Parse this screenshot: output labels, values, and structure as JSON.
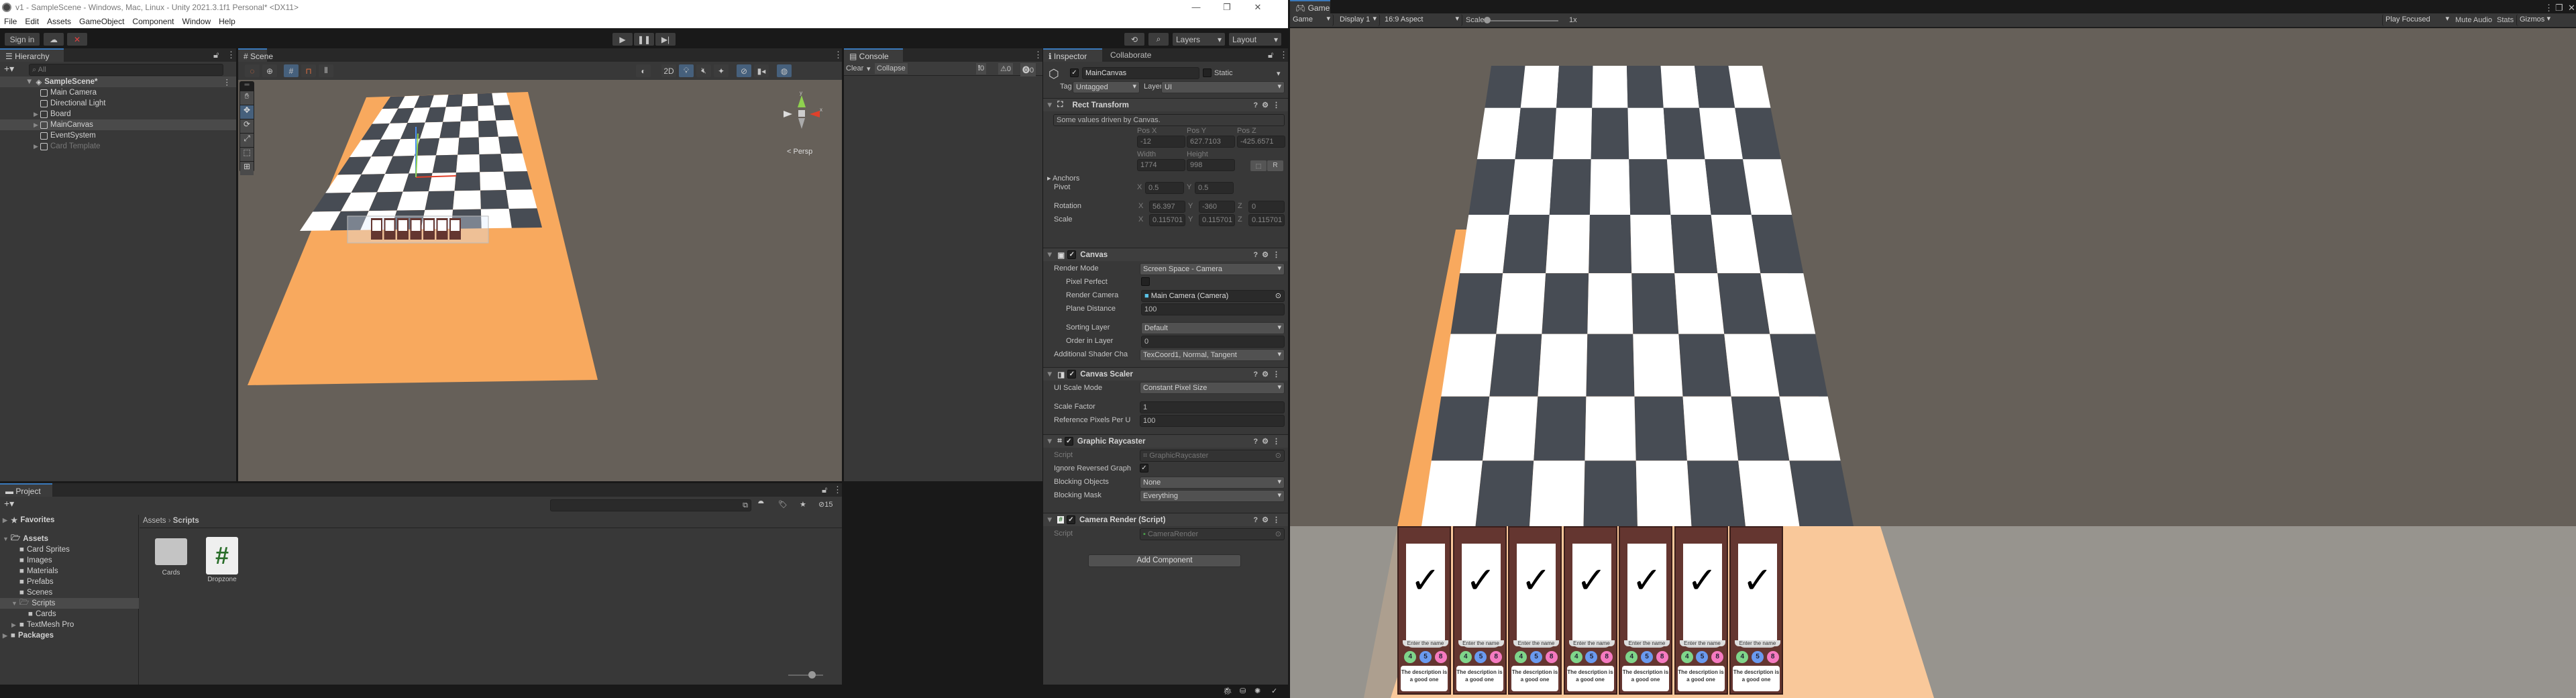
{
  "window": {
    "title": "v1 - SampleScene - Windows, Mac, Linux - Unity 2021.3.1f1 Personal* <DX11>",
    "menu": [
      "File",
      "Edit",
      "Assets",
      "GameObject",
      "Component",
      "Window",
      "Help"
    ]
  },
  "toolbar": {
    "sign_in": "Sign in",
    "play_controls": [
      "play",
      "pause",
      "step"
    ],
    "layers": "Layers",
    "layout": "Layout"
  },
  "hierarchy": {
    "tab": "Hierarchy",
    "search_placeholder": "All",
    "scene": "SampleScene*",
    "items": [
      {
        "label": "Main Camera",
        "expandable": false,
        "disabled": false,
        "selected": false
      },
      {
        "label": "Directional Light",
        "expandable": false,
        "disabled": false,
        "selected": false
      },
      {
        "label": "Board",
        "expandable": true,
        "disabled": false,
        "selected": false
      },
      {
        "label": "MainCanvas",
        "expandable": true,
        "disabled": false,
        "selected": true
      },
      {
        "label": "EventSystem",
        "expandable": false,
        "disabled": false,
        "selected": false
      },
      {
        "label": "Card Template",
        "expandable": true,
        "disabled": true,
        "selected": false
      }
    ]
  },
  "scene": {
    "tab": "Scene",
    "toolbar_2d": "2D",
    "persp_label": "< Persp",
    "gizmo_axes": {
      "y": "y",
      "x": "x"
    },
    "board": {
      "rows": 8,
      "cols": 8,
      "light": "#ffffff",
      "dark": "#474c54",
      "border": "#f8a95e"
    },
    "card_count": 7
  },
  "console": {
    "tab": "Console",
    "clear": "Clear",
    "collapse": "Collapse",
    "counts": {
      "log": "0",
      "warning": "0",
      "error": "0"
    }
  },
  "inspector": {
    "tab": "Inspector",
    "tab2": "Collaborate",
    "object_name": "MainCanvas",
    "active": true,
    "static_label": "Static",
    "tag_label": "Tag",
    "tag": "Untagged",
    "layer_label": "Layer",
    "layer": "UI",
    "rect_transform": {
      "title": "Rect Transform",
      "note": "Some values driven by Canvas.",
      "pos_x_label": "Pos X",
      "pos_y_label": "Pos Y",
      "pos_z_label": "Pos Z",
      "pos_x": "-12",
      "pos_y": "627.7103",
      "pos_z": "-425.6571",
      "width_label": "Width",
      "height_label": "Height",
      "width": "1774",
      "height": "998",
      "r_button": "R",
      "anchors": "Anchors",
      "pivot_label": "Pivot",
      "pivot_x": "0.5",
      "pivot_y": "0.5",
      "rotation_label": "Rotation",
      "rot_x": "56.397",
      "rot_y": "-360",
      "rot_z": "0",
      "scale_label": "Scale",
      "scale_x": "0.115701",
      "scale_y": "0.115701",
      "scale_z": "0.115701"
    },
    "canvas": {
      "title": "Canvas",
      "render_mode_label": "Render Mode",
      "render_mode": "Screen Space - Camera",
      "pixel_perfect_label": "Pixel Perfect",
      "pixel_perfect": false,
      "render_camera_label": "Render Camera",
      "render_camera": "Main Camera (Camera)",
      "plane_distance_label": "Plane Distance",
      "plane_distance": "100",
      "sorting_layer_label": "Sorting Layer",
      "sorting_layer": "Default",
      "order_label": "Order in Layer",
      "order": "0",
      "shader_label": "Additional Shader Cha",
      "shader": "TexCoord1, Normal, Tangent"
    },
    "canvas_scaler": {
      "title": "Canvas Scaler",
      "mode_label": "UI Scale Mode",
      "mode": "Constant Pixel Size",
      "scale_factor_label": "Scale Factor",
      "scale_factor": "1",
      "ref_ppu_label": "Reference Pixels Per U",
      "ref_ppu": "100"
    },
    "graphic_raycaster": {
      "title": "Graphic Raycaster",
      "script_label": "Script",
      "script": "GraphicRaycaster",
      "ignore_label": "Ignore Reversed Graph",
      "ignore": true,
      "blocking_objects_label": "Blocking Objects",
      "blocking_objects": "None",
      "blocking_mask_label": "Blocking Mask",
      "blocking_mask": "Everything"
    },
    "camera_render": {
      "title": "Camera Render (Script)",
      "script_label": "Script",
      "script": "CameraRender"
    },
    "add_component": "Add Component"
  },
  "project": {
    "tab": "Project",
    "hidden_count": "15",
    "tree": [
      {
        "label": "Favorites",
        "level": 0,
        "bold": true,
        "icon": "star",
        "arrow": "right"
      },
      {
        "label": "Assets",
        "level": 0,
        "bold": true,
        "icon": "folder-open",
        "arrow": "down"
      },
      {
        "label": "Card Sprites",
        "level": 1,
        "icon": "folder"
      },
      {
        "label": "Images",
        "level": 1,
        "icon": "folder"
      },
      {
        "label": "Materials",
        "level": 1,
        "icon": "folder"
      },
      {
        "label": "Prefabs",
        "level": 1,
        "icon": "folder"
      },
      {
        "label": "Scenes",
        "level": 1,
        "icon": "folder"
      },
      {
        "label": "Scripts",
        "level": 1,
        "icon": "folder-open",
        "arrow": "down",
        "selected": true
      },
      {
        "label": "Cards",
        "level": 2,
        "icon": "folder"
      },
      {
        "label": "TextMesh Pro",
        "level": 1,
        "icon": "folder",
        "arrow": "right"
      },
      {
        "label": "Packages",
        "level": 0,
        "bold": true,
        "icon": "folder",
        "arrow": "right"
      }
    ],
    "breadcrumb": [
      "Assets",
      "Scripts"
    ],
    "assets": [
      {
        "label": "Cards",
        "type": "folder"
      },
      {
        "label": "Dropzone",
        "type": "script"
      }
    ]
  },
  "game": {
    "tab": "Game",
    "mode": "Game",
    "display": "Display 1",
    "aspect": "16:9 Aspect",
    "scale_label": "Scale",
    "scale_value": "1x",
    "play_focused": "Play Focused",
    "mute_audio": "Mute Audio",
    "stats": "Stats",
    "gizmos": "Gizmos",
    "cards": [
      {
        "name": "Enter the name",
        "stats": [
          "4",
          "5",
          "8"
        ],
        "description": "The description is a good one"
      },
      {
        "name": "Enter the name",
        "stats": [
          "4",
          "5",
          "8"
        ],
        "description": "The description is a good one"
      },
      {
        "name": "Enter the name",
        "stats": [
          "4",
          "5",
          "8"
        ],
        "description": "The description is a good one"
      },
      {
        "name": "Enter the name",
        "stats": [
          "4",
          "5",
          "8"
        ],
        "description": "The description is a good one"
      },
      {
        "name": "Enter the name",
        "stats": [
          "4",
          "5",
          "8"
        ],
        "description": "The description is a good one"
      },
      {
        "name": "Enter the name",
        "stats": [
          "4",
          "5",
          "8"
        ],
        "description": "The description is a good one"
      },
      {
        "name": "Enter the name",
        "stats": [
          "4",
          "5",
          "8"
        ],
        "description": "The description is a good one"
      }
    ],
    "stat_colors": [
      "#7fd58a",
      "#6a9af0",
      "#f57ac0"
    ],
    "card_frame": "#643630"
  }
}
